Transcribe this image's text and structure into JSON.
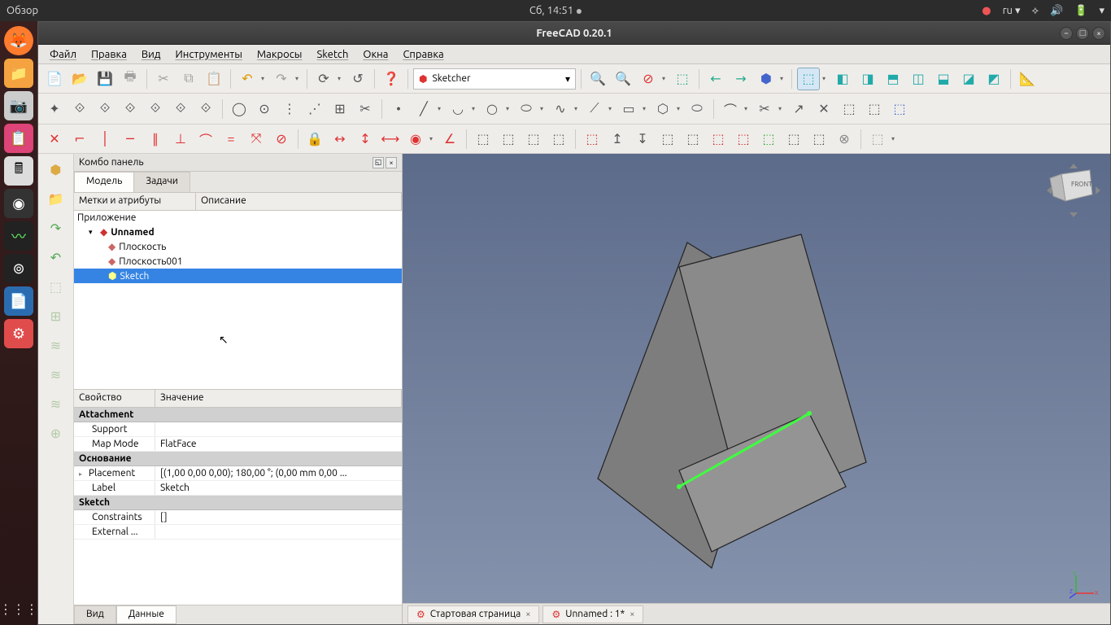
{
  "gnome": {
    "activities": "Обзор",
    "clock": "Сб, 14:51",
    "lang": "ru"
  },
  "window": {
    "title": "FreeCAD 0.20.1"
  },
  "menu": [
    "Файл",
    "Правка",
    "Вид",
    "Инструменты",
    "Макросы",
    "Sketch",
    "Окна",
    "Справка"
  ],
  "workbench": "Sketcher",
  "combo": {
    "title": "Комбо панель",
    "tabs": {
      "model": "Модель",
      "tasks": "Задачи"
    },
    "tree_headers": {
      "labels": "Метки и атрибуты",
      "desc": "Описание"
    },
    "app_label": "Приложение",
    "doc_name": "Unnamed",
    "items": [
      "Плоскость",
      "Плоскость001",
      "Sketch"
    ],
    "prop_headers": {
      "prop": "Свойство",
      "val": "Значение"
    },
    "groups": {
      "attachment": "Attachment",
      "base": "Основание",
      "sketch": "Sketch"
    },
    "props": {
      "support": {
        "k": "Support",
        "v": ""
      },
      "mapmode": {
        "k": "Map Mode",
        "v": "FlatFace"
      },
      "placement": {
        "k": "Placement",
        "v": "[(1,00 0,00 0,00); 180,00 °; (0,00 mm  0,00 ..."
      },
      "label": {
        "k": "Label",
        "v": "Sketch"
      },
      "constraints": {
        "k": "Constraints",
        "v": "[]"
      },
      "external": {
        "k": "External ...",
        "v": ""
      }
    },
    "bottom_tabs": {
      "view": "Вид",
      "data": "Данные"
    }
  },
  "doc_tabs": [
    {
      "label": "Стартовая страница"
    },
    {
      "label": "Unnamed : 1*"
    }
  ]
}
